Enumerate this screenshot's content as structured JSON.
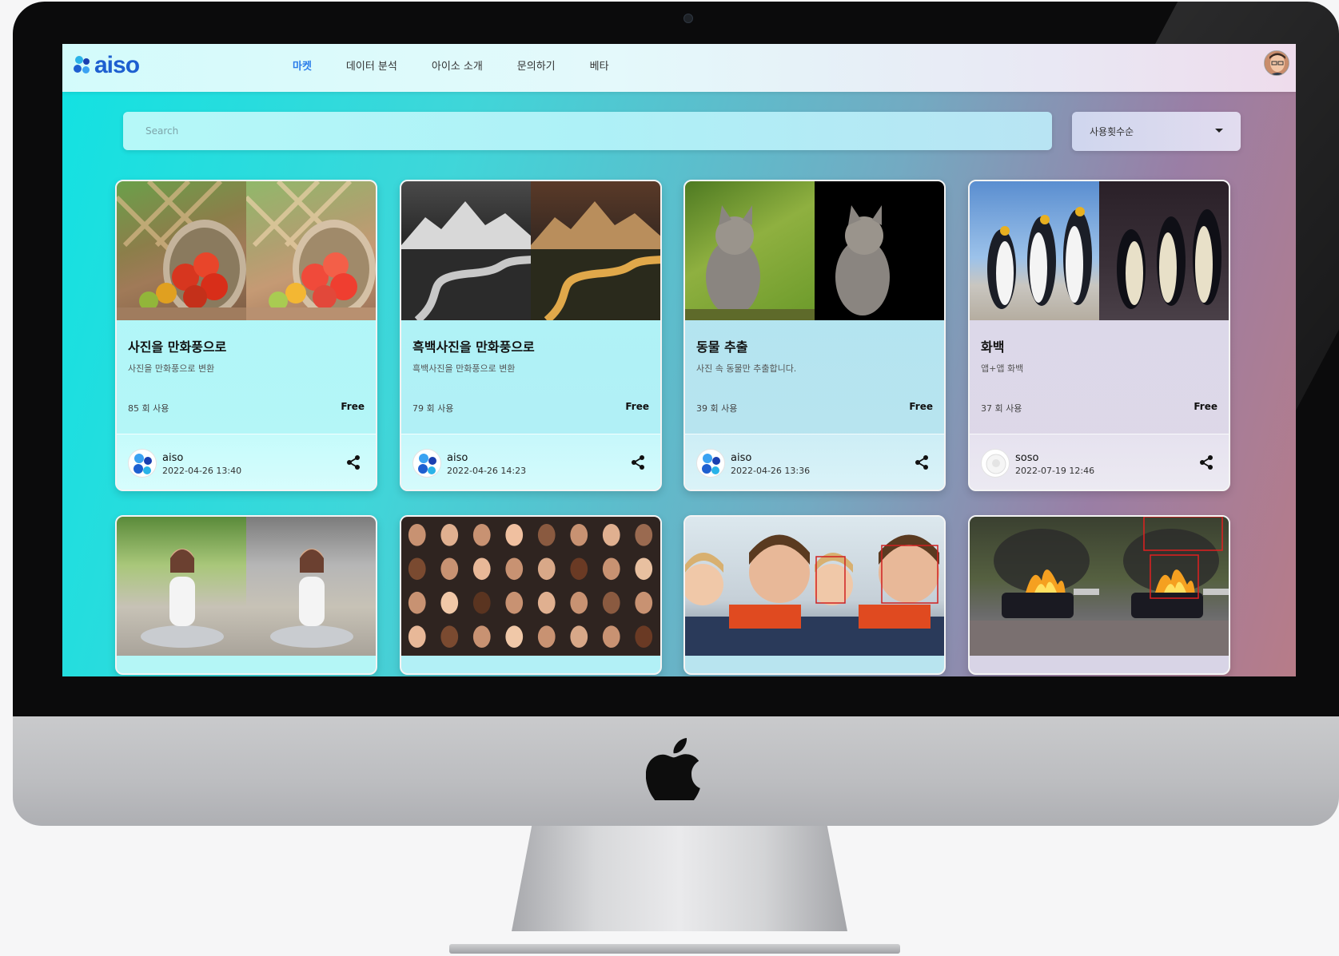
{
  "brand": {
    "logo_text": "aiso",
    "logo_colors": [
      "#2ab3e8",
      "#1d5fd0",
      "#1a3fb0",
      "#3aa2f2"
    ]
  },
  "nav": {
    "items": [
      {
        "label": "마켓",
        "active": true
      },
      {
        "label": "데이터 분석",
        "active": false
      },
      {
        "label": "아이소 소개",
        "active": false
      },
      {
        "label": "문의하기",
        "active": false
      },
      {
        "label": "베타",
        "active": false
      }
    ]
  },
  "search": {
    "placeholder": "Search"
  },
  "sort": {
    "selected": "사용횟수순"
  },
  "cards": [
    {
      "title": "사진을 만화풍으로",
      "desc": "사진을 만화풍으로 변환",
      "uses": "85 회 사용",
      "price": "Free",
      "author": "aiso",
      "date": "2022-04-26 13:40",
      "image": "fruit-basket"
    },
    {
      "title": "흑백사진을 만화풍으로",
      "desc": "흑백사진을 만화풍으로 변환",
      "uses": "79 회 사용",
      "price": "Free",
      "author": "aiso",
      "date": "2022-04-26 14:23",
      "image": "mountain-river"
    },
    {
      "title": "동물 추출",
      "desc": "사진 속 동물만 추출합니다.",
      "uses": "39 회 사용",
      "price": "Free",
      "author": "aiso",
      "date": "2022-04-26 13:36",
      "image": "kitten"
    },
    {
      "title": "화백",
      "desc": "앱+앱 화백",
      "uses": "37 회 사용",
      "price": "Free",
      "author": "soso",
      "date": "2022-07-19 12:46",
      "image": "penguins"
    }
  ],
  "cards_row2": [
    {
      "image": "meditating-woman"
    },
    {
      "image": "face-grid"
    },
    {
      "image": "boy-face-detection"
    },
    {
      "image": "burning-car"
    }
  ]
}
